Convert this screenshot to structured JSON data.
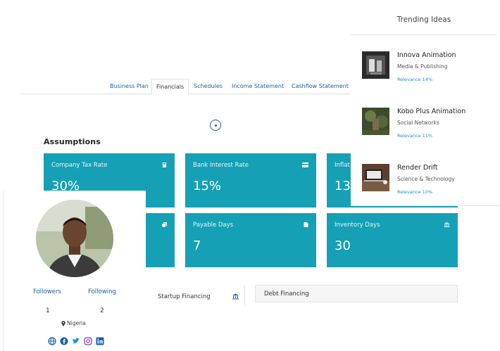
{
  "tabs": [
    {
      "label": "Business Plan",
      "active": false
    },
    {
      "label": "Financials",
      "active": true
    },
    {
      "label": "Schedules",
      "active": false
    },
    {
      "label": "Income Statement",
      "active": false
    },
    {
      "label": "Cashflow Statement",
      "active": false
    }
  ],
  "assumptions": {
    "title": "Assumptions",
    "cards": [
      {
        "label": "Company Tax Rate",
        "value": "30%",
        "icon": "calculator-icon"
      },
      {
        "label": "Bank Interest Rate",
        "value": "15%",
        "icon": "credit-card-icon"
      },
      {
        "label": "Inflat",
        "value": "13%",
        "icon": ""
      },
      {
        "label": "",
        "value": "",
        "icon": "copy-icon"
      },
      {
        "label": "Payable Days",
        "value": "7",
        "icon": "document-icon"
      },
      {
        "label": "Inventory Days",
        "value": "30",
        "icon": "bank-icon"
      }
    ]
  },
  "financing": {
    "startup_label": "Startup Financing",
    "debt_label": "Debt Financing"
  },
  "profile": {
    "followers_label": "Followers",
    "following_label": "Following",
    "followers_count": "1",
    "following_count": "2",
    "location": "Nigeria",
    "socials": [
      "globe-icon",
      "facebook-icon",
      "twitter-icon",
      "instagram-icon",
      "linkedin-icon"
    ]
  },
  "trending": {
    "title": "Trending Ideas",
    "items": [
      {
        "name": "Innova Animation",
        "category": "Media & Publishing",
        "relevance": "Relevance 14%"
      },
      {
        "name": "Kobo Plus Animation",
        "category": "Social Networks",
        "relevance": "Relevance 11%"
      },
      {
        "name": "Render Drift",
        "category": "Science & Technology",
        "relevance": "Relevance 10%"
      }
    ]
  },
  "colors": {
    "card": "#16a0b5",
    "link": "#1a5fa8",
    "relevance": "#1a8fd6"
  }
}
